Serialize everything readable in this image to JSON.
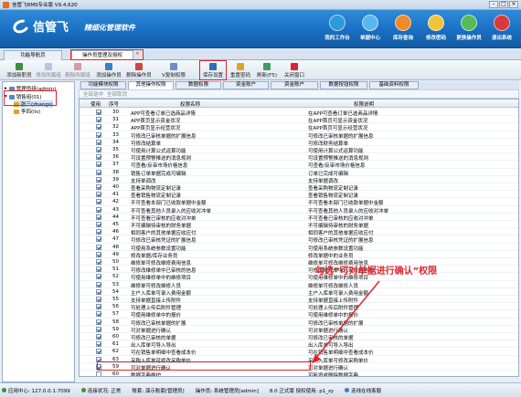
{
  "window": {
    "title": "信管飞RMS专业版 V9.4.620"
  },
  "banner": {
    "brand": "信管飞",
    "slogan": "精细化管理软件",
    "buttons": [
      "我的工作台",
      "单据中心",
      "库存查询",
      "修改密码",
      "更换操作员",
      "退出系统"
    ]
  },
  "main_tabs": [
    "功能导航页",
    "操作员管理及授权"
  ],
  "toolbar": [
    "添加新职员",
    "修改所属组",
    "删除所属组",
    "添加操作员",
    "删除操作员",
    "V复制权限",
    "保存设置",
    "重置密码",
    "刷新(F5)",
    "关闭窗口"
  ],
  "tree": {
    "root": "管理员组(admin)",
    "group": "销售组(01)",
    "child1": "张三(zhangs)",
    "child2": "李四(lis)"
  },
  "sub_tabs": [
    "功能模块权限",
    "其他操作权限",
    "数据权限",
    "资金账户",
    "资金账户",
    "数据按钮权限",
    "基础资料权限"
  ],
  "subbar": [
    "全部选中",
    "全部取消"
  ],
  "grid": {
    "headers": [
      "使用",
      "序号",
      "权限名称",
      "权限说明"
    ],
    "rows": [
      [
        "30",
        "APP可查看订单已选商品详情",
        "在APP可查看订单已选商品详情"
      ],
      [
        "31",
        "APP首页显示资金状况",
        "在APP首页可显示资金状况"
      ],
      [
        "32",
        "APP首页显示经营状况",
        "在APP首页可显示经营状况"
      ],
      [
        "33",
        "可修改已审核单据的扩展信息",
        "可修改已审核单据的扩展信息"
      ],
      [
        "34",
        "可修改结算单",
        "可修改财务结算单"
      ],
      [
        "35",
        "可使用计算公式运算功能",
        "可使用计算公式运算功能"
      ],
      [
        "36",
        "可设置预警推送的消息规则",
        "可设置预警推送的消息规则"
      ],
      [
        "37",
        "可查看/反审市场价格信息",
        "可查看/反审市场价格信息"
      ],
      [
        "38",
        "销售订单单据完成可编辑",
        "订单已完成可编辑"
      ],
      [
        "39",
        "支持单调改",
        "支持单据调改"
      ],
      [
        "40",
        "查看采购物流定制记录",
        "查看采购物流定制记录"
      ],
      [
        "41",
        "查看销售物流定制记录",
        "查看销售物流定制记录"
      ],
      [
        "42",
        "不可查看本部门已收款单据中金额",
        "不可查看本部门已收款单据中金额"
      ],
      [
        "43",
        "不可查看其他人员录入的应收对冲单",
        "不可查看其他人员录入的应收对冲单"
      ],
      [
        "44",
        "不可查看已审核的应收对冲单",
        "不可查看已审核的应收对冲单"
      ],
      [
        "45",
        "不可编辑待审核的财务单据",
        "不可编辑待审核的财务单据"
      ],
      [
        "46",
        "相同客户的其他单据应收应付",
        "相同客户的其他单据应收应付"
      ],
      [
        "47",
        "可修改已审核凭证的扩展信息",
        "可修改已审核凭证的扩展信息"
      ],
      [
        "48",
        "可使用系统参数设置功能",
        "可使用系统参数设置功能"
      ],
      [
        "49",
        "修改单据/库存业务员",
        "修改单据中的业务员"
      ],
      [
        "50",
        "维修单可修改维修费用信息",
        "维修单可修改维修费用信息"
      ],
      [
        "51",
        "可修改维修单中已审核的信息",
        "可修改维修单中已审核的信息"
      ],
      [
        "52",
        "可使用维修单中的维修项目",
        "可使用维修单中的维修项目"
      ],
      [
        "53",
        "维修单可修改维修人员",
        "维修单可修改维修人员"
      ],
      [
        "54",
        "主户入库单可录入费用金额",
        "主户入库单可录入费用金额"
      ],
      [
        "55",
        "支持单据直接上传附件",
        "支持单据直接上传附件"
      ],
      [
        "56",
        "可处理上传后附件管理",
        "可处理上传后附件管理"
      ],
      [
        "57",
        "可使用维修单中的报价",
        "可使用维修单中的报价"
      ],
      [
        "58",
        "可修改已审核单据的扩展",
        "可修改已审核单据的扩展"
      ],
      [
        "59",
        "可对单据进行确认",
        "可对单据进行确认"
      ],
      [
        "60",
        "可修改已审核的单据",
        "可修改已审核的单据"
      ],
      [
        "61",
        "出入库单可导入导出",
        "出入库单可导入导出"
      ],
      [
        "62",
        "可在销售单明细中查看成本价",
        "可在销售单明细中查看成本价"
      ],
      [
        "63",
        "采购入库单可修改采购单价",
        "采购入库单可修改采购单价"
      ],
      [
        "59",
        "可对单据进行确认",
        "可对单据进行确认"
      ],
      [
        "60",
        "数据字典维护",
        "可新增或删除数据字典"
      ]
    ]
  },
  "annotation": "勾选“可对单据进行确认”权限",
  "status": {
    "app_server": "应用中心: 127.0.0.1:7099",
    "conn": "连接状况: 正常",
    "account": "账套: 演示账套[管理员]",
    "operator": "操作员: 系统管理员[admin]",
    "license": "8.0 正式版 授权使用: p1_zy",
    "help": "连线在线客服"
  }
}
